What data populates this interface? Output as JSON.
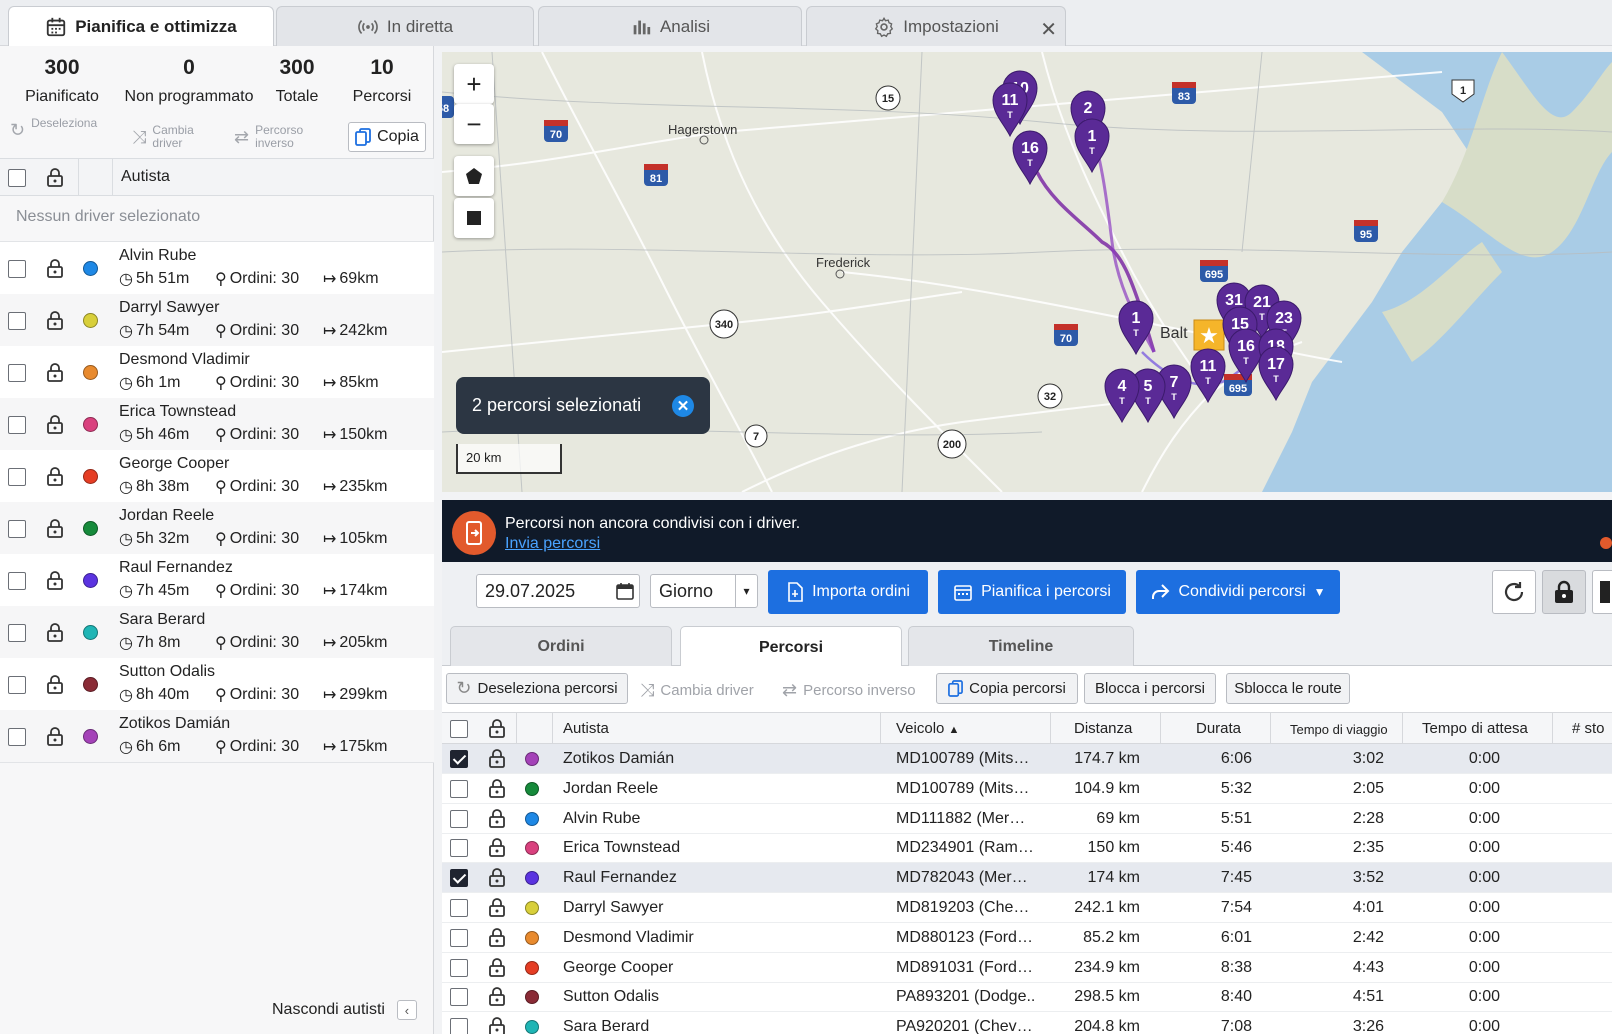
{
  "tabs": [
    {
      "label": "Pianifica e ottimizza",
      "active": true
    },
    {
      "label": "In diretta"
    },
    {
      "label": "Analisi"
    },
    {
      "label": "Impostazioni"
    }
  ],
  "stats": [
    {
      "value": "300",
      "label": "Pianificato"
    },
    {
      "value": "0",
      "label": "Non programmato"
    },
    {
      "value": "300",
      "label": "Totale"
    },
    {
      "value": "10",
      "label": "Percorsi"
    }
  ],
  "left_toolbar": {
    "deselect": "Deseleziona",
    "change_driver_1": "Cambia",
    "change_driver_2": "driver",
    "reverse_1": "Percorso",
    "reverse_2": "inverso",
    "copy": "Copia"
  },
  "left_table": {
    "header_driver": "Autista",
    "no_driver": "Nessun driver selezionato"
  },
  "orders_label": "Ordini: 30",
  "drivers": [
    {
      "name": "Alvin Rube",
      "time": "5h 51m",
      "orders": "Ordini: 30",
      "dist": "69km",
      "color": "#1e88e5"
    },
    {
      "name": "Darryl Sawyer",
      "time": "7h 54m",
      "orders": "Ordini: 30",
      "dist": "242km",
      "color": "#d8cf3a"
    },
    {
      "name": "Desmond Vladimir",
      "time": "6h 1m",
      "orders": "Ordini: 30",
      "dist": "85km",
      "color": "#e88a2e"
    },
    {
      "name": "Erica Townstead",
      "time": "5h 46m",
      "orders": "Ordini: 30",
      "dist": "150km",
      "color": "#d9417e"
    },
    {
      "name": "George Cooper",
      "time": "8h 38m",
      "orders": "Ordini: 30",
      "dist": "235km",
      "color": "#e53d24"
    },
    {
      "name": "Jordan Reele",
      "time": "5h 32m",
      "orders": "Ordini: 30",
      "dist": "105km",
      "color": "#168a3b"
    },
    {
      "name": "Raul Fernandez",
      "time": "7h 45m",
      "orders": "Ordini: 30",
      "dist": "174km",
      "color": "#5b33e0"
    },
    {
      "name": "Sara Berard",
      "time": "7h 8m",
      "orders": "Ordini: 30",
      "dist": "205km",
      "color": "#1fb5b5"
    },
    {
      "name": "Sutton Odalis",
      "time": "8h 40m",
      "orders": "Ordini: 30",
      "dist": "299km",
      "color": "#8a2b36"
    },
    {
      "name": "Zotikos Damián",
      "time": "6h 6m",
      "orders": "Ordini: 30",
      "dist": "175km",
      "color": "#a442b8"
    }
  ],
  "hide_drivers": "Nascondi autisti",
  "map": {
    "zoom_in": "+",
    "zoom_out": "−",
    "selection_pill": "2 percorsi selezionati",
    "scale": "20 km",
    "places": [
      "Hagerstown",
      "Frederick",
      "Balt"
    ],
    "shields": [
      "70",
      "81",
      "15",
      "83",
      "1",
      "95",
      "695",
      "70",
      "340",
      "32",
      "7",
      "200",
      "695",
      "58"
    ],
    "pin_labels": [
      "10",
      "11",
      "16",
      "2",
      "1",
      "1",
      "31",
      "21",
      "23",
      "15",
      "16",
      "18",
      "17",
      "11",
      "7",
      "5",
      "4"
    ]
  },
  "banner": {
    "text": "Percorsi non ancora condivisi con i driver.",
    "link": "Invia percorsi"
  },
  "toolbar": {
    "date": "29.07.2025",
    "period": "Giorno",
    "import": "Importa ordini",
    "plan": "Pianifica i percorsi",
    "share": "Condividi percorsi"
  },
  "subtabs": [
    {
      "label": "Ordini"
    },
    {
      "label": "Percorsi",
      "active": true
    },
    {
      "label": "Timeline"
    }
  ],
  "actions": {
    "deselect": "Deseleziona percorsi",
    "change_driver": "Cambia driver",
    "reverse": "Percorso inverso",
    "copy": "Copia percorsi",
    "lock": "Blocca i percorsi",
    "unlock": "Sblocca le route"
  },
  "route_table": {
    "headers": {
      "driver": "Autista",
      "vehicle": "Veicolo",
      "distance": "Distanza",
      "duration": "Durata",
      "travel": "Tempo di viaggio",
      "wait": "Tempo di attesa",
      "stops": "# sto"
    },
    "rows": [
      {
        "checked": true,
        "color": "#a442b8",
        "driver": "Zotikos Damián",
        "vehicle": "MD100789 (Mits…",
        "distance": "174.7 km",
        "duration": "6:06",
        "travel": "3:02",
        "wait": "0:00"
      },
      {
        "checked": false,
        "color": "#168a3b",
        "driver": "Jordan Reele",
        "vehicle": "MD100789 (Mits…",
        "distance": "104.9 km",
        "duration": "5:32",
        "travel": "2:05",
        "wait": "0:00"
      },
      {
        "checked": false,
        "color": "#1e88e5",
        "driver": "Alvin Rube",
        "vehicle": "MD111882 (Mer…",
        "distance": "69 km",
        "duration": "5:51",
        "travel": "2:28",
        "wait": "0:00"
      },
      {
        "checked": false,
        "color": "#d9417e",
        "driver": "Erica Townstead",
        "vehicle": "MD234901 (Ram…",
        "distance": "150 km",
        "duration": "5:46",
        "travel": "2:35",
        "wait": "0:00"
      },
      {
        "checked": true,
        "color": "#5b33e0",
        "driver": "Raul Fernandez",
        "vehicle": "MD782043 (Mer…",
        "distance": "174 km",
        "duration": "7:45",
        "travel": "3:52",
        "wait": "0:00"
      },
      {
        "checked": false,
        "color": "#d8cf3a",
        "driver": "Darryl Sawyer",
        "vehicle": "MD819203 (Che…",
        "distance": "242.1 km",
        "duration": "7:54",
        "travel": "4:01",
        "wait": "0:00"
      },
      {
        "checked": false,
        "color": "#e88a2e",
        "driver": "Desmond Vladimir",
        "vehicle": "MD880123 (Ford…",
        "distance": "85.2 km",
        "duration": "6:01",
        "travel": "2:42",
        "wait": "0:00"
      },
      {
        "checked": false,
        "color": "#e53d24",
        "driver": "George Cooper",
        "vehicle": "MD891031 (Ford…",
        "distance": "234.9 km",
        "duration": "8:38",
        "travel": "4:43",
        "wait": "0:00"
      },
      {
        "checked": false,
        "color": "#8a2b36",
        "driver": "Sutton Odalis",
        "vehicle": "PA893201 (Dodge..",
        "distance": "298.5 km",
        "duration": "8:40",
        "travel": "4:51",
        "wait": "0:00"
      },
      {
        "checked": false,
        "color": "#1fb5b5",
        "driver": "Sara Berard",
        "vehicle": "PA920201 (Chev…",
        "distance": "204.8 km",
        "duration": "7:08",
        "travel": "3:26",
        "wait": "0:00"
      }
    ]
  }
}
